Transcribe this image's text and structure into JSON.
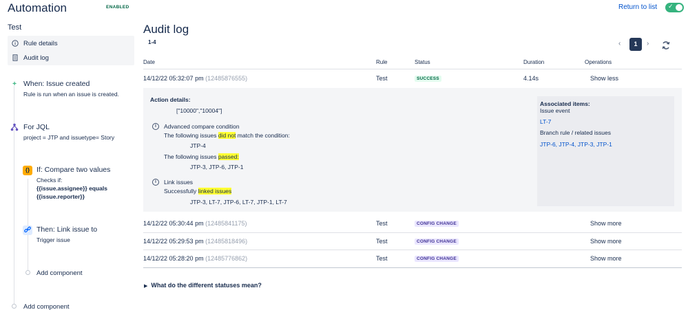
{
  "header": {
    "title": "Automation",
    "enabled_badge": "ENABLED",
    "return_link": "Return to list",
    "toggle_state": "on"
  },
  "sidebar": {
    "rule_name": "Test",
    "items": [
      {
        "label": "Rule details",
        "icon": "info-icon"
      },
      {
        "label": "Audit log",
        "icon": "document-icon"
      }
    ],
    "steps": [
      {
        "title": "When: Issue created",
        "desc": "Rule is run when an issue is created.",
        "icon": "plus-icon",
        "color": "#36b37e"
      },
      {
        "title": "For JQL",
        "desc": "project = JTP and issuetype= Story",
        "icon": "branch-icon",
        "color": "#6554c0"
      },
      {
        "title": "If: Compare two values",
        "desc_1": "Checks if:",
        "desc_2": "{{issue.assignee}} equals",
        "desc_3": "{{issue.reporter}}",
        "icon": "condition-icon",
        "color": "#ffab00"
      },
      {
        "title": "Then: Link issue to",
        "desc": "Trigger issue",
        "icon": "link-icon",
        "color": "#0065ff"
      }
    ],
    "add_component_inner": "Add component",
    "add_component_outer": "Add component"
  },
  "main": {
    "title": "Audit log",
    "range": "1-4",
    "pagination": {
      "current_page": "1",
      "prev": "‹",
      "next": "›"
    },
    "columns": {
      "date": "Date",
      "rule": "Rule",
      "status": "Status",
      "duration": "Duration",
      "operations": "Operations"
    },
    "rows": [
      {
        "date": "14/12/22 05:32:07 pm",
        "id": "(12485876555)",
        "rule": "Test",
        "status": "SUCCESS",
        "duration": "4.14s",
        "operation": "Show less"
      },
      {
        "date": "14/12/22 05:30:44 pm",
        "id": "(12485841175)",
        "rule": "Test",
        "status": "CONFIG CHANGE",
        "duration": "",
        "operation": "Show more"
      },
      {
        "date": "14/12/22 05:29:53 pm",
        "id": "(12485818496)",
        "rule": "Test",
        "status": "CONFIG CHANGE",
        "duration": "",
        "operation": "Show more"
      },
      {
        "date": "14/12/22 05:28:20 pm",
        "id": "(12485776862)",
        "rule": "Test",
        "status": "CONFIG CHANGE",
        "duration": "",
        "operation": "Show more"
      }
    ],
    "details": {
      "action_details_label": "Action details:",
      "action_values": "[\"10000\",\"10004\"]",
      "compare_title": "Advanced compare condition",
      "compare_fail_pre": "The following issues ",
      "compare_fail_hl": "did not",
      "compare_fail_post": " match the condition:",
      "compare_fail_issues": "JTP-4",
      "compare_pass_pre": "The following issues ",
      "compare_pass_hl": "passed:",
      "compare_pass_issues": "JTP-3, JTP-6, JTP-1",
      "link_title": "Link issues",
      "link_pre": "Successfully ",
      "link_hl": "linked issues",
      "link_issues": "JTP-3, LT-7, JTP-6, LT-7, JTP-1, LT-7",
      "assoc_title": "Associated items:",
      "assoc_event": "Issue event",
      "assoc_event_item": "LT-7",
      "assoc_branch": "Branch rule / related issues",
      "assoc_branch_items": "JTP-6, JTP-4, JTP-3, JTP-1"
    },
    "statuses_question": "What do the different statuses mean?"
  }
}
